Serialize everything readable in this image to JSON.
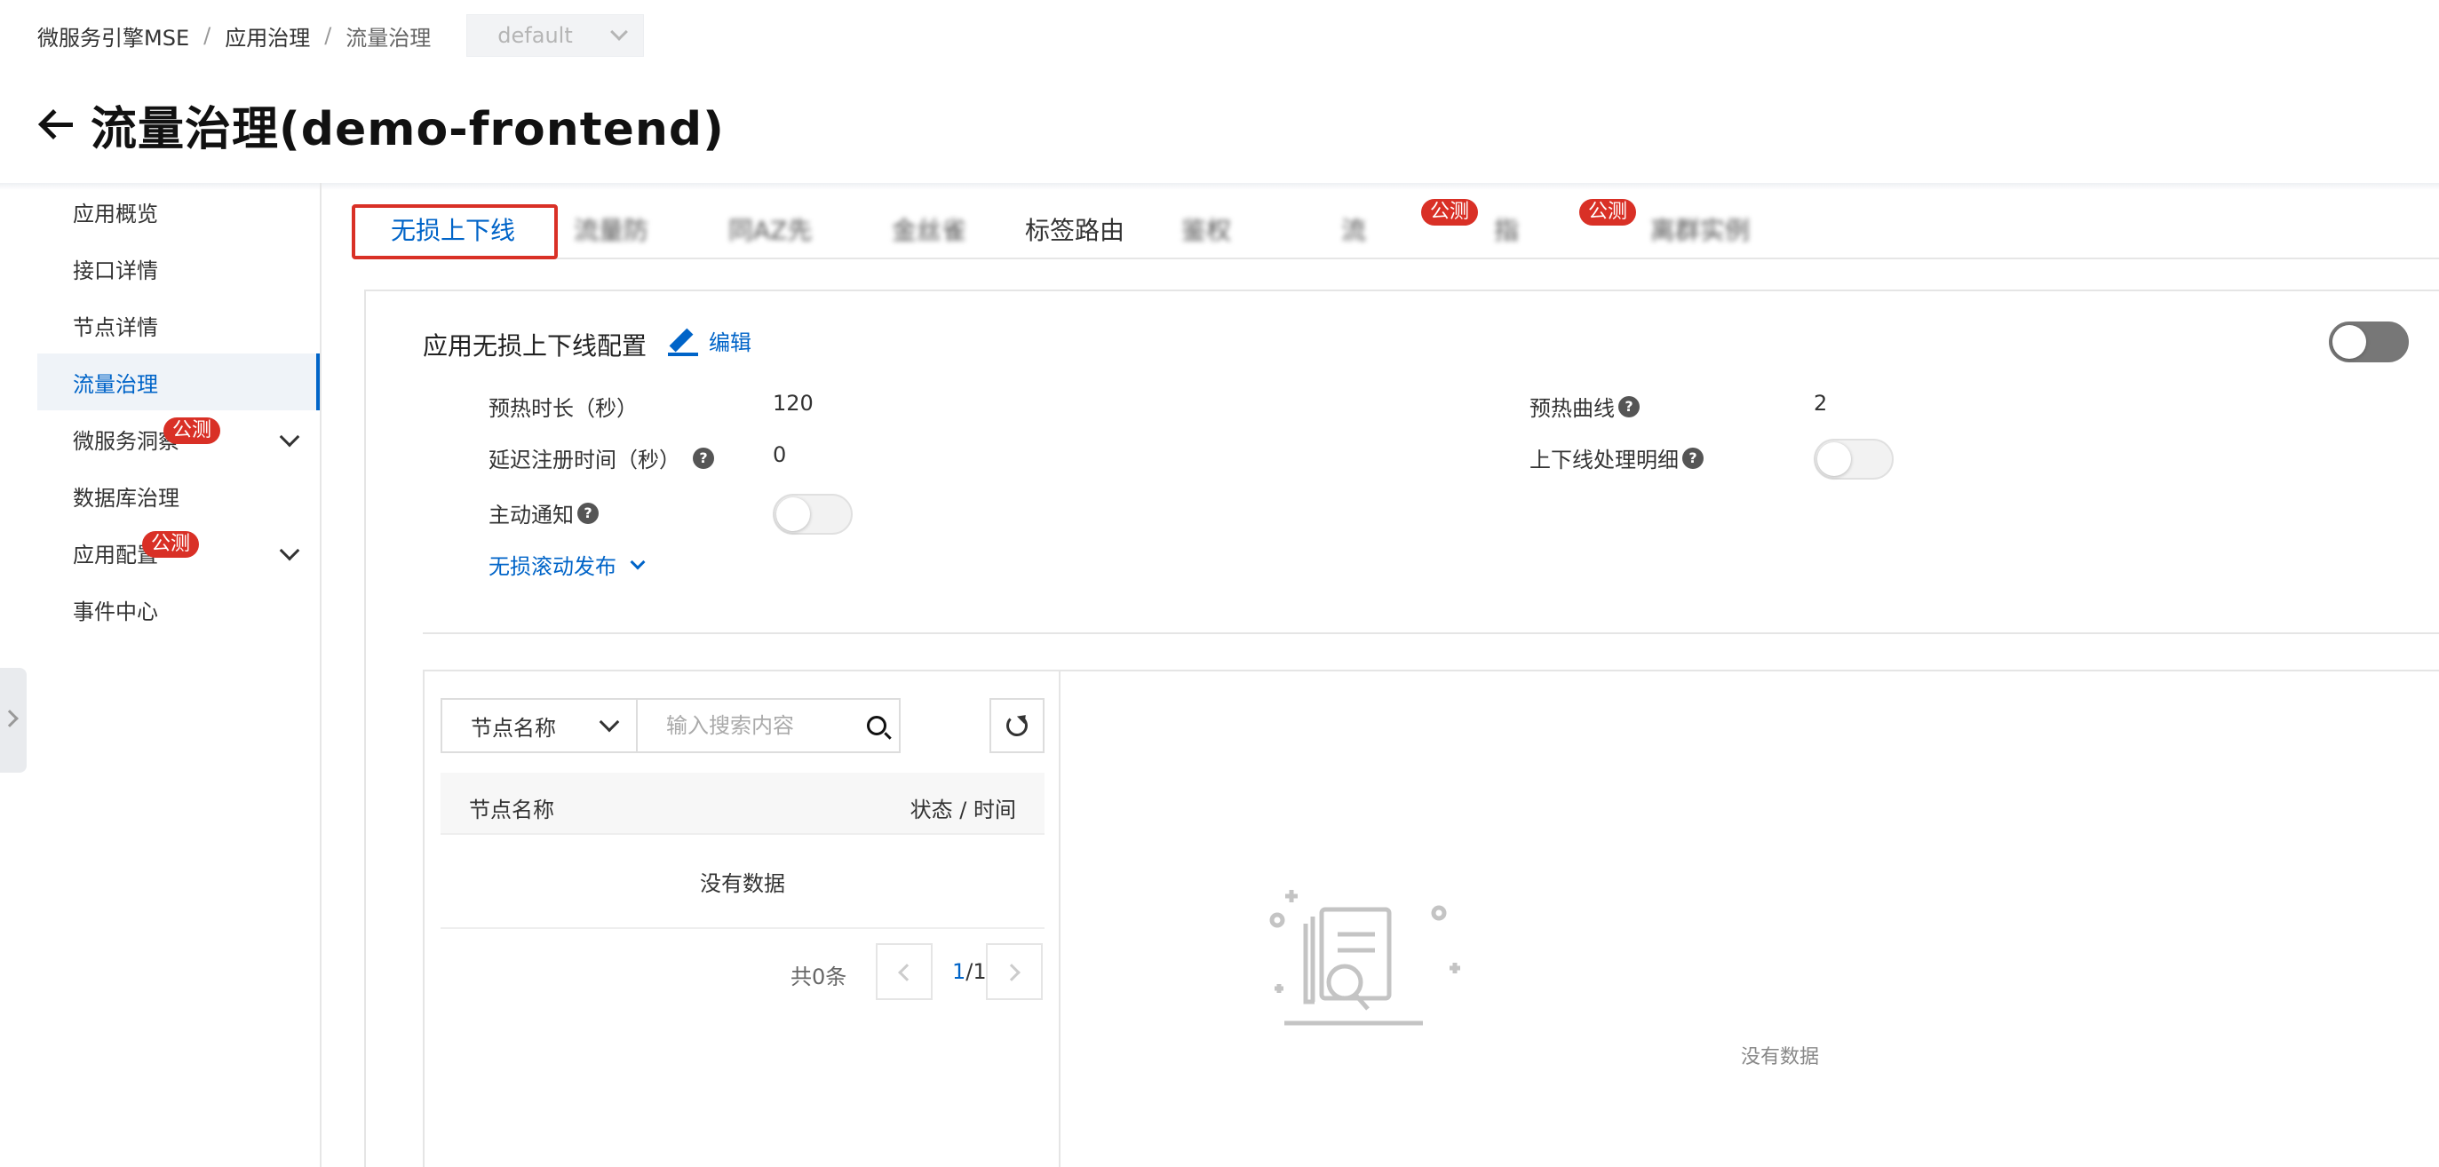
{
  "breadcrumb": {
    "root": "微服务引擎MSE",
    "parent": "应用治理",
    "current": "流量治理",
    "sep": "/"
  },
  "namespace_select": {
    "value": "default"
  },
  "page": {
    "title": "流量治理(demo-frontend)"
  },
  "sidebar": {
    "items": [
      {
        "label": "应用概览"
      },
      {
        "label": "接口详情"
      },
      {
        "label": "节点详情"
      },
      {
        "label": "流量治理"
      },
      {
        "label": "微服务洞察",
        "badge": "公测"
      },
      {
        "label": "数据库治理"
      },
      {
        "label": "应用配置",
        "badge": "公测"
      },
      {
        "label": "事件中心"
      }
    ]
  },
  "tabs": [
    {
      "label": "无损上下线"
    },
    {
      "label": "流量防"
    },
    {
      "label": "同AZ先"
    },
    {
      "label": "金丝雀"
    },
    {
      "label": "标签路由"
    },
    {
      "label": "鉴权"
    },
    {
      "label": "流",
      "badge": "公测"
    },
    {
      "label": "指",
      "badge": "公测"
    },
    {
      "label": "离群实例"
    }
  ],
  "config": {
    "title": "应用无损上下线配置",
    "edit_label": "编辑",
    "warmup_duration_label": "预热时长（秒）",
    "warmup_duration_value": "120",
    "warmup_curve_label": "预热曲线",
    "warmup_curve_value": "2",
    "delay_register_label": "延迟注册时间（秒）",
    "delay_register_value": "0",
    "online_offline_detail_label": "上下线处理明细",
    "active_notify_label": "主动通知",
    "rolling_release_label": "无损滚动发布",
    "help_glyph": "?"
  },
  "nodes": {
    "filter_value": "节点名称",
    "search_placeholder": "输入搜索内容",
    "columns": {
      "name": "节点名称",
      "status_time": "状态 / 时间"
    },
    "empty_text": "没有数据",
    "total": "共0条",
    "page_current": "1",
    "page_total": "/1"
  },
  "detail": {
    "empty_text": "没有数据"
  }
}
